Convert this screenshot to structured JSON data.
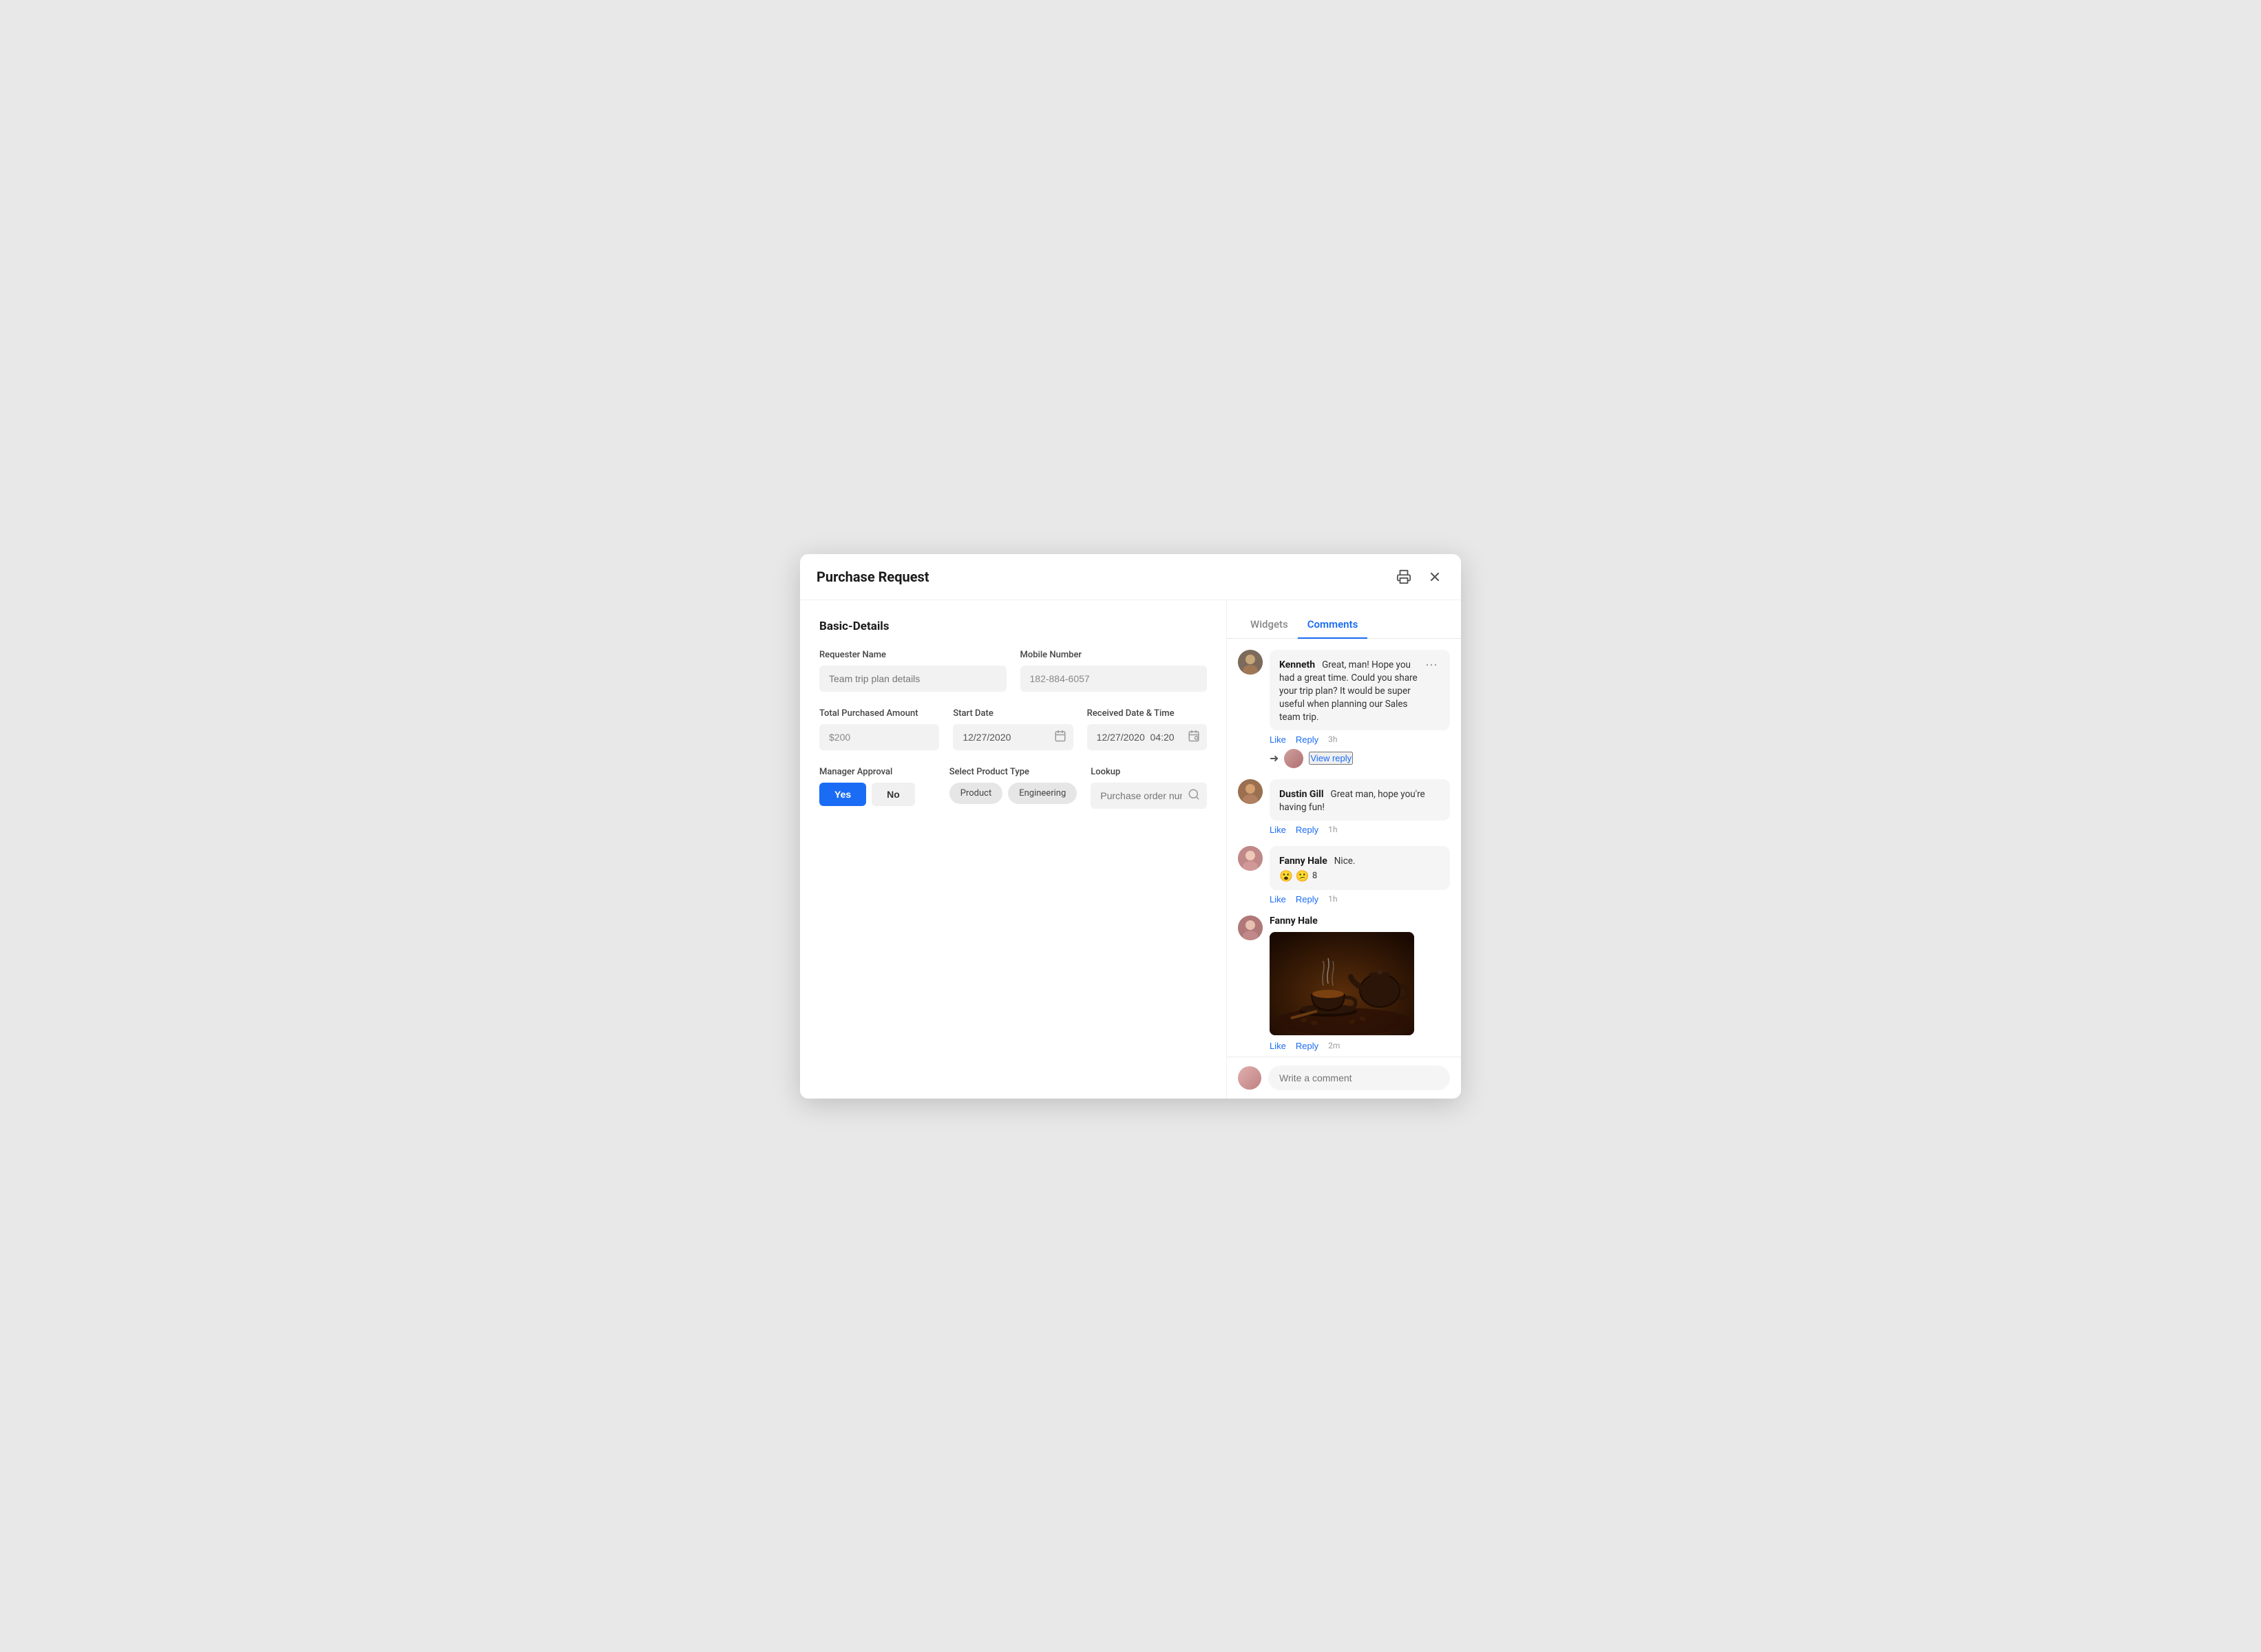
{
  "modal": {
    "title": "Purchase Request",
    "print_icon": "🖨",
    "close_icon": "✕"
  },
  "form": {
    "section_title": "Basic-Details",
    "requester_name_label": "Requester Name",
    "requester_name_placeholder": "Team trip plan details",
    "mobile_number_label": "Mobile Number",
    "mobile_number_value": "182-884-6057",
    "total_purchased_amount_label": "Total Purchased Amount",
    "total_purchased_amount_value": "$200",
    "start_date_label": "Start Date",
    "start_date_value": "12/27/2020",
    "received_date_label": "Received Date & Time",
    "received_date_value": "12/27/2020  04:20",
    "manager_approval_label": "Manager Approval",
    "yes_label": "Yes",
    "no_label": "No",
    "select_product_type_label": "Select Product Type",
    "product_chip": "Product",
    "engineering_chip": "Engineering",
    "lookup_label": "Lookup",
    "lookup_placeholder": "Purchase order number..."
  },
  "sidebar": {
    "tab_widgets": "Widgets",
    "tab_comments": "Comments",
    "active_tab": "Comments"
  },
  "comments": [
    {
      "id": "1",
      "author": "Kenneth",
      "text": "Great, man! Hope you had a great time. Could you share your trip plan? It would be super useful when planning our Sales team trip.",
      "time": "3h",
      "has_more": true,
      "has_view_reply": true
    },
    {
      "id": "2",
      "author": "Dustin Gill",
      "text": "Great man, hope you're having fun!",
      "time": "1h",
      "has_more": false,
      "has_view_reply": false
    },
    {
      "id": "3",
      "author": "Fanny Hale",
      "text": "Nice.",
      "time": "1h",
      "has_emojis": true,
      "emoji1": "😮",
      "emoji2": "😕",
      "emoji_count": "8",
      "has_more": false,
      "has_view_reply": false
    },
    {
      "id": "4",
      "author": "Fanny Hale",
      "has_image": true,
      "time": "2m",
      "has_more": false,
      "has_view_reply": false
    }
  ],
  "comment_input_placeholder": "Write a comment",
  "action_labels": {
    "like": "Like",
    "reply": "Reply",
    "view_reply": "View reply"
  }
}
